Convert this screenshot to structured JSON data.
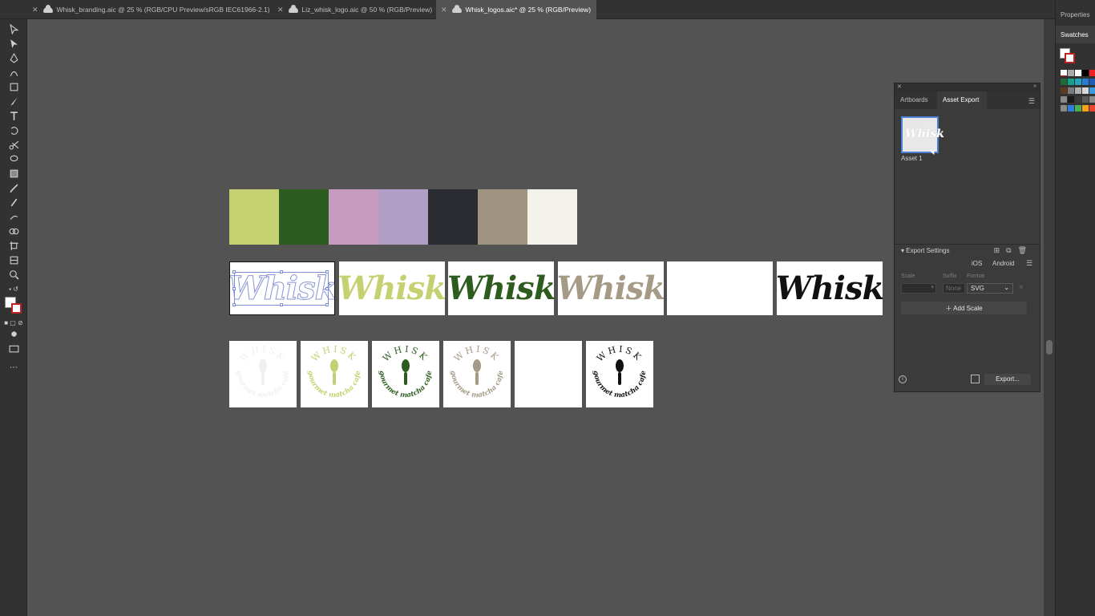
{
  "tabs": [
    {
      "title": "Whisk_branding.aic @ 25 % (RGB/CPU Preview/sRGB IEC61966-2.1)",
      "active": false
    },
    {
      "title": "Liz_whisk_logo.aic @ 50 % (RGB/Preview)",
      "active": false
    },
    {
      "title": "Whisk_logos.aic* @ 25 % (RGB/Preview)",
      "active": true
    }
  ],
  "close_glyph": "✕",
  "right_panel": {
    "properties_label": "Properties",
    "swatches_label": "Swatches"
  },
  "palette": [
    "#c5d170",
    "#2d5d1e",
    "#c79ac0",
    "#b19ec6",
    "#2a2c31",
    "#9f9480",
    "#f3f2ea"
  ],
  "wordmarks": [
    {
      "text": "Whisk",
      "color": "#ffffff",
      "outline": "#8895d6",
      "selected": true
    },
    {
      "text": "Whisk",
      "color": "#c5d170"
    },
    {
      "text": "Whisk",
      "color": "#2d5d1e"
    },
    {
      "text": "Whisk",
      "color": "#a49a86"
    },
    {
      "text": "",
      "color": "#ffffff"
    },
    {
      "text": "Whisk",
      "color": "#111111"
    }
  ],
  "badges": [
    {
      "top": "WHISK",
      "bottom": "gourmet matcha cafe",
      "color": "#f0f0f0"
    },
    {
      "top": "WHISK",
      "bottom": "gourmet matcha cafe",
      "color": "#c5d170"
    },
    {
      "top": "WHISK",
      "bottom": "gourmet matcha cafe",
      "color": "#2d5d1e"
    },
    {
      "top": "WHISK",
      "bottom": "gourmet matcha cafe",
      "color": "#a49a86"
    },
    {
      "top": "",
      "bottom": "",
      "color": "#ffffff"
    },
    {
      "top": "WHISK",
      "bottom": "gourmet matcha cafe",
      "color": "#111111"
    }
  ],
  "asset_export": {
    "tab_artboards": "Artboards",
    "tab_asset_export": "Asset Export",
    "asset_thumb_text": "Whisk",
    "asset_name": "Asset 1",
    "export_settings": "Export Settings",
    "ios": "iOS",
    "android": "Android",
    "col_scale": "Scale",
    "col_suffix": "Suffix",
    "col_format": "Format",
    "suffix_placeholder": "None",
    "format_value": "SVG",
    "add_scale": "Add Scale",
    "export_button": "Export...",
    "info_glyph": "i"
  }
}
